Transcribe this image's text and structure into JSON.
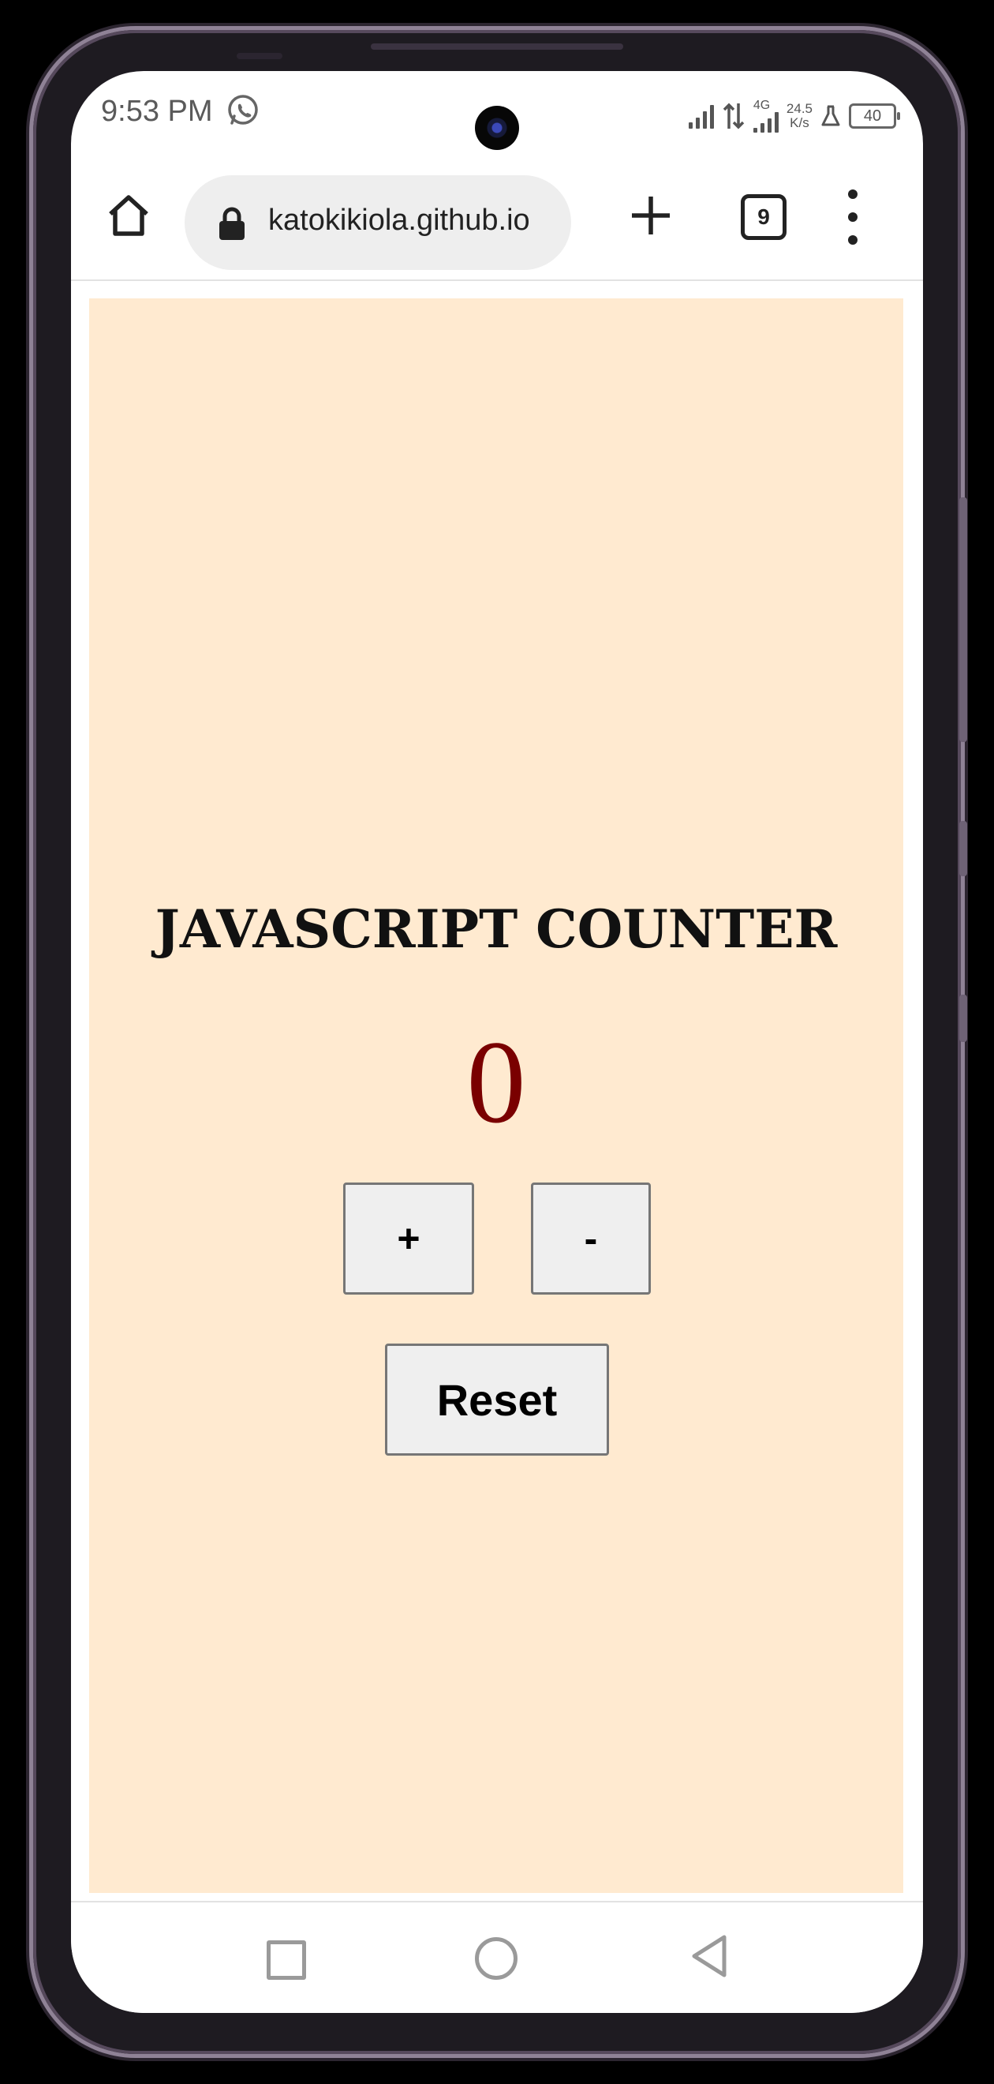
{
  "status_bar": {
    "time": "9:53 PM",
    "network_label": "4G",
    "speed_value": "24.5",
    "speed_unit": "K/s",
    "battery": "40"
  },
  "browser": {
    "url": "katokikiola.github.io",
    "tab_count": "9"
  },
  "page": {
    "heading": "JAVASCRIPT COUNTER",
    "count": "0",
    "increment_label": "+",
    "decrement_label": "-",
    "reset_label": "Reset"
  },
  "colors": {
    "page_background": "#ffead0",
    "count_color": "#7a0000",
    "button_background": "#efefef"
  },
  "icons": [
    "whatsapp-icon",
    "signal-icon",
    "data-arrows-icon",
    "lab-flask-icon",
    "battery-icon",
    "home-icon",
    "lock-icon",
    "plus-icon",
    "tab-switcher-icon",
    "more-vert-icon",
    "recent-apps-icon",
    "home-nav-icon",
    "back-nav-icon"
  ]
}
